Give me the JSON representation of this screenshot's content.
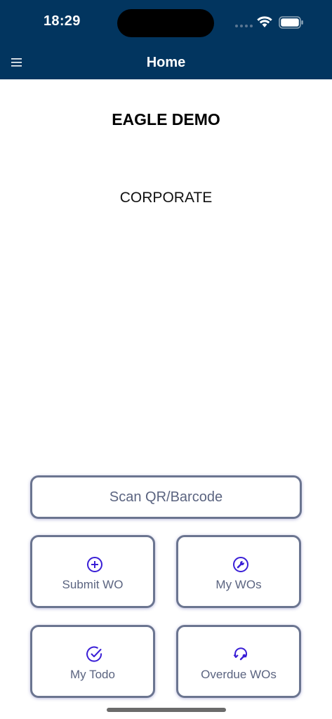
{
  "status_bar": {
    "time": "18:29"
  },
  "header": {
    "title": "Home",
    "menu_icon": "hamburger-menu-icon"
  },
  "main": {
    "org_name": "EAGLE DEMO",
    "org_unit": "CORPORATE"
  },
  "actions": {
    "scan_label": "Scan QR/Barcode",
    "tiles": [
      {
        "label": "Submit WO",
        "icon": "plus-circle-icon"
      },
      {
        "label": "My WOs",
        "icon": "wrench-circle-icon"
      },
      {
        "label": "My Todo",
        "icon": "check-circle-icon"
      },
      {
        "label": "Overdue WOs",
        "icon": "overdue-refresh-icon"
      }
    ]
  },
  "colors": {
    "header_bg": "#02355f",
    "button_border": "#6b7590",
    "button_text": "#5b6480",
    "icon_accent": "#3a1fd6"
  }
}
